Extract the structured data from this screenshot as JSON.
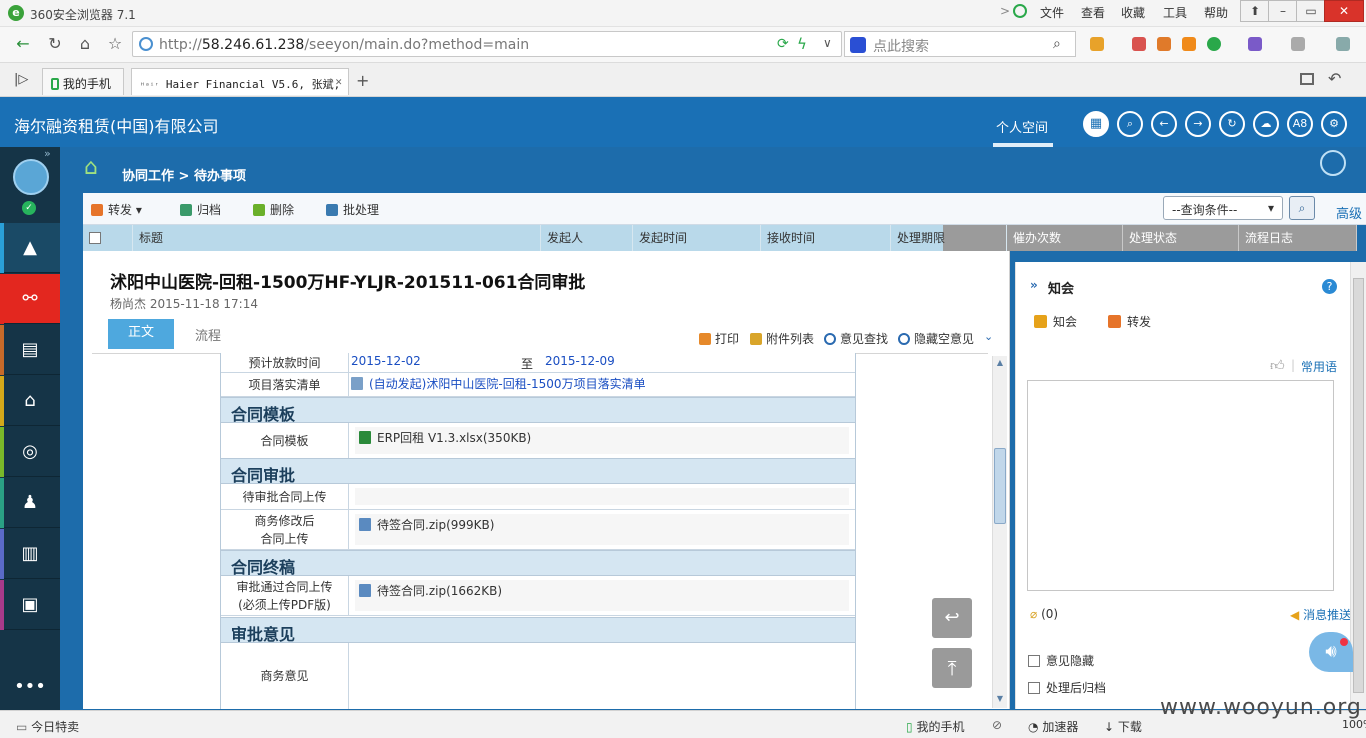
{
  "browser": {
    "title": "360安全浏览器 7.1",
    "menu": [
      "文件",
      "查看",
      "收藏",
      "工具",
      "帮助"
    ],
    "url_prefix": "http://",
    "url_host": "58.246.61.238",
    "url_path": "/seeyon/main.do?method=main",
    "search_placeholder": "点此搜索",
    "tabs": [
      {
        "label": "我的手机"
      },
      {
        "label": "Haier Financial V5.6, 张斌,"
      }
    ],
    "new_tab": "+"
  },
  "app": {
    "company": "海尔融资租赁(中国)有限公司",
    "personal_space": "个人空间",
    "header_icons": [
      "grid-icon",
      "search-icon",
      "back-icon",
      "forward-icon",
      "refresh-icon",
      "cloud-icon",
      "a8-icon",
      "gear-icon"
    ],
    "a8_label": "A8",
    "breadcrumb": "协同工作 > 待办事项"
  },
  "toolbar": {
    "forward": "转发",
    "archive": "归档",
    "delete": "删除",
    "batch": "批处理",
    "query": "--查询条件--",
    "advanced": "高级"
  },
  "grid": {
    "columns": [
      "标题",
      "发起人",
      "发起时间",
      "接收时间",
      "处理期限",
      "催办次数",
      "处理状态",
      "流程日志"
    ]
  },
  "doc": {
    "title": "沭阳中山医院-回租-1500万HF-YLJR-201511-061合同审批",
    "author": "杨尚杰",
    "datetime": "2015-11-18 17:14",
    "tab_body": "正文",
    "tab_flow": "流程",
    "actions": {
      "print": "打印",
      "attachments": "附件列表",
      "opinion_search": "意见查找",
      "hide_empty": "隐藏空意见"
    },
    "form": {
      "row_loan_label": "预计放款时间",
      "row_loan_from": "2015-12-02",
      "row_loan_to_label": "至",
      "row_loan_to": "2015-12-09",
      "row_project_label": "项目落实清单",
      "row_project_link": "(自动发起)沭阳中山医院-回租-1500万项目落实清单",
      "section_template": "合同模板",
      "template_label": "合同模板",
      "template_file": "ERP回租 V1.3.xlsx(350KB)",
      "section_review": "合同审批",
      "review_upload_label": "待审批合同上传",
      "biz_modified_label_1": "商务修改后",
      "biz_modified_label_2": "合同上传",
      "biz_modified_file": "待签合同.zip(999KB)",
      "section_final": "合同终稿",
      "final_label_1": "审批通过合同上传",
      "final_label_2": "(必须上传PDF版)",
      "final_file": "待签合同.zip(1662KB)",
      "section_opinion": "审批意见",
      "biz_opinion_label": "商务意见"
    }
  },
  "side": {
    "title": "知会",
    "help": "?",
    "notify": "知会",
    "forward": "转发",
    "common_phrases": "常用语",
    "attach_count": "(0)",
    "push": "消息推送",
    "hide_opinion": "意见隐藏",
    "archive_after": "处理后归档"
  },
  "status": {
    "today": "今日特卖",
    "myphone": "我的手机",
    "accelerator": "加速器",
    "download": "下载",
    "zoom": "100%"
  },
  "watermark": "www.wooyun.org",
  "colors": {
    "header": "#1a70b5",
    "rail": "#153447",
    "section_bg": "#d5e6f2",
    "link": "#1a4ec2"
  }
}
